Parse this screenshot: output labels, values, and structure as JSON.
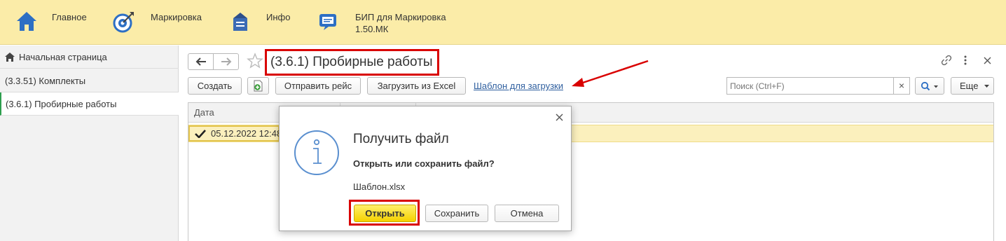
{
  "sections": [
    {
      "label": "Главное",
      "icon": "home-icon"
    },
    {
      "label": "Маркировка",
      "icon": "target-icon"
    },
    {
      "label": "Инфо",
      "icon": "info-box-icon"
    },
    {
      "label": "БИП для Маркировка\n1.50.МК",
      "icon": "chat-icon"
    }
  ],
  "left_panel": {
    "items": [
      {
        "label": "Начальная страница"
      },
      {
        "label": "(3.3.51) Комплекты"
      },
      {
        "label": "(3.6.1) Пробирные работы"
      }
    ]
  },
  "form": {
    "title": "(3.6.1) Пробирные работы",
    "toolbar": {
      "create": "Создать",
      "send_trip": "Отправить рейс",
      "load_excel": "Загрузить из Excel",
      "template_link": "Шаблон для загрузки",
      "search_placeholder": "Поиск (Ctrl+F)",
      "more": "Еще"
    },
    "table": {
      "columns": [
        "Дата"
      ],
      "rows": [
        {
          "date": "05.12.2022 12:48"
        }
      ]
    }
  },
  "dialog": {
    "title": "Получить файл",
    "question": "Открыть или сохранить файл?",
    "filename": "Шаблон.xlsx",
    "open": "Открыть",
    "save": "Сохранить",
    "cancel": "Отмена"
  },
  "colors": {
    "topbar": "#fbeca8",
    "highlight_red": "#d90000",
    "primary_button": "#f5d100",
    "link": "#2f5f9f",
    "active_marker": "#2e9e4e"
  }
}
